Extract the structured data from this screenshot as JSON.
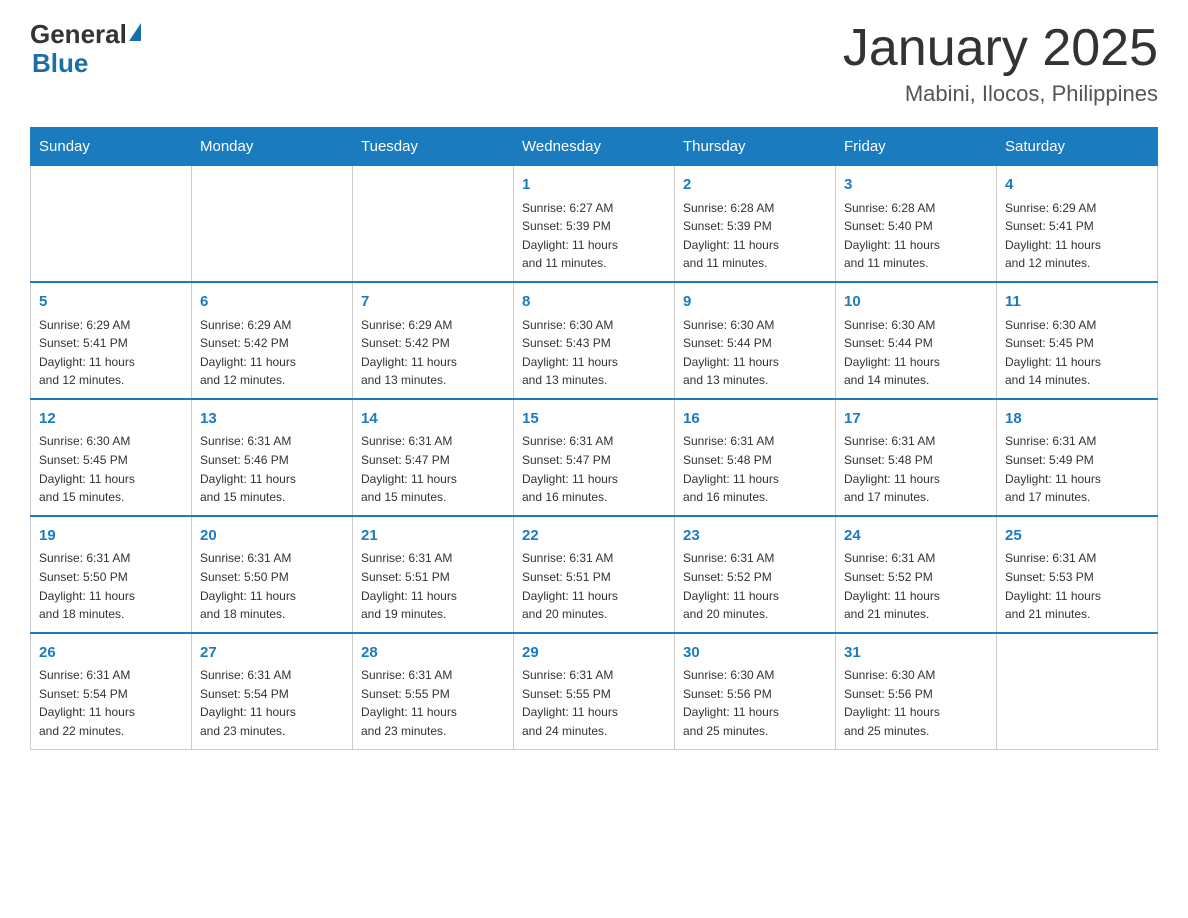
{
  "header": {
    "logo_line1": "General",
    "logo_line2": "Blue",
    "month": "January 2025",
    "location": "Mabini, Ilocos, Philippines"
  },
  "days_of_week": [
    "Sunday",
    "Monday",
    "Tuesday",
    "Wednesday",
    "Thursday",
    "Friday",
    "Saturday"
  ],
  "weeks": [
    [
      {
        "day": "",
        "info": ""
      },
      {
        "day": "",
        "info": ""
      },
      {
        "day": "",
        "info": ""
      },
      {
        "day": "1",
        "info": "Sunrise: 6:27 AM\nSunset: 5:39 PM\nDaylight: 11 hours\nand 11 minutes."
      },
      {
        "day": "2",
        "info": "Sunrise: 6:28 AM\nSunset: 5:39 PM\nDaylight: 11 hours\nand 11 minutes."
      },
      {
        "day": "3",
        "info": "Sunrise: 6:28 AM\nSunset: 5:40 PM\nDaylight: 11 hours\nand 11 minutes."
      },
      {
        "day": "4",
        "info": "Sunrise: 6:29 AM\nSunset: 5:41 PM\nDaylight: 11 hours\nand 12 minutes."
      }
    ],
    [
      {
        "day": "5",
        "info": "Sunrise: 6:29 AM\nSunset: 5:41 PM\nDaylight: 11 hours\nand 12 minutes."
      },
      {
        "day": "6",
        "info": "Sunrise: 6:29 AM\nSunset: 5:42 PM\nDaylight: 11 hours\nand 12 minutes."
      },
      {
        "day": "7",
        "info": "Sunrise: 6:29 AM\nSunset: 5:42 PM\nDaylight: 11 hours\nand 13 minutes."
      },
      {
        "day": "8",
        "info": "Sunrise: 6:30 AM\nSunset: 5:43 PM\nDaylight: 11 hours\nand 13 minutes."
      },
      {
        "day": "9",
        "info": "Sunrise: 6:30 AM\nSunset: 5:44 PM\nDaylight: 11 hours\nand 13 minutes."
      },
      {
        "day": "10",
        "info": "Sunrise: 6:30 AM\nSunset: 5:44 PM\nDaylight: 11 hours\nand 14 minutes."
      },
      {
        "day": "11",
        "info": "Sunrise: 6:30 AM\nSunset: 5:45 PM\nDaylight: 11 hours\nand 14 minutes."
      }
    ],
    [
      {
        "day": "12",
        "info": "Sunrise: 6:30 AM\nSunset: 5:45 PM\nDaylight: 11 hours\nand 15 minutes."
      },
      {
        "day": "13",
        "info": "Sunrise: 6:31 AM\nSunset: 5:46 PM\nDaylight: 11 hours\nand 15 minutes."
      },
      {
        "day": "14",
        "info": "Sunrise: 6:31 AM\nSunset: 5:47 PM\nDaylight: 11 hours\nand 15 minutes."
      },
      {
        "day": "15",
        "info": "Sunrise: 6:31 AM\nSunset: 5:47 PM\nDaylight: 11 hours\nand 16 minutes."
      },
      {
        "day": "16",
        "info": "Sunrise: 6:31 AM\nSunset: 5:48 PM\nDaylight: 11 hours\nand 16 minutes."
      },
      {
        "day": "17",
        "info": "Sunrise: 6:31 AM\nSunset: 5:48 PM\nDaylight: 11 hours\nand 17 minutes."
      },
      {
        "day": "18",
        "info": "Sunrise: 6:31 AM\nSunset: 5:49 PM\nDaylight: 11 hours\nand 17 minutes."
      }
    ],
    [
      {
        "day": "19",
        "info": "Sunrise: 6:31 AM\nSunset: 5:50 PM\nDaylight: 11 hours\nand 18 minutes."
      },
      {
        "day": "20",
        "info": "Sunrise: 6:31 AM\nSunset: 5:50 PM\nDaylight: 11 hours\nand 18 minutes."
      },
      {
        "day": "21",
        "info": "Sunrise: 6:31 AM\nSunset: 5:51 PM\nDaylight: 11 hours\nand 19 minutes."
      },
      {
        "day": "22",
        "info": "Sunrise: 6:31 AM\nSunset: 5:51 PM\nDaylight: 11 hours\nand 20 minutes."
      },
      {
        "day": "23",
        "info": "Sunrise: 6:31 AM\nSunset: 5:52 PM\nDaylight: 11 hours\nand 20 minutes."
      },
      {
        "day": "24",
        "info": "Sunrise: 6:31 AM\nSunset: 5:52 PM\nDaylight: 11 hours\nand 21 minutes."
      },
      {
        "day": "25",
        "info": "Sunrise: 6:31 AM\nSunset: 5:53 PM\nDaylight: 11 hours\nand 21 minutes."
      }
    ],
    [
      {
        "day": "26",
        "info": "Sunrise: 6:31 AM\nSunset: 5:54 PM\nDaylight: 11 hours\nand 22 minutes."
      },
      {
        "day": "27",
        "info": "Sunrise: 6:31 AM\nSunset: 5:54 PM\nDaylight: 11 hours\nand 23 minutes."
      },
      {
        "day": "28",
        "info": "Sunrise: 6:31 AM\nSunset: 5:55 PM\nDaylight: 11 hours\nand 23 minutes."
      },
      {
        "day": "29",
        "info": "Sunrise: 6:31 AM\nSunset: 5:55 PM\nDaylight: 11 hours\nand 24 minutes."
      },
      {
        "day": "30",
        "info": "Sunrise: 6:30 AM\nSunset: 5:56 PM\nDaylight: 11 hours\nand 25 minutes."
      },
      {
        "day": "31",
        "info": "Sunrise: 6:30 AM\nSunset: 5:56 PM\nDaylight: 11 hours\nand 25 minutes."
      },
      {
        "day": "",
        "info": ""
      }
    ]
  ]
}
